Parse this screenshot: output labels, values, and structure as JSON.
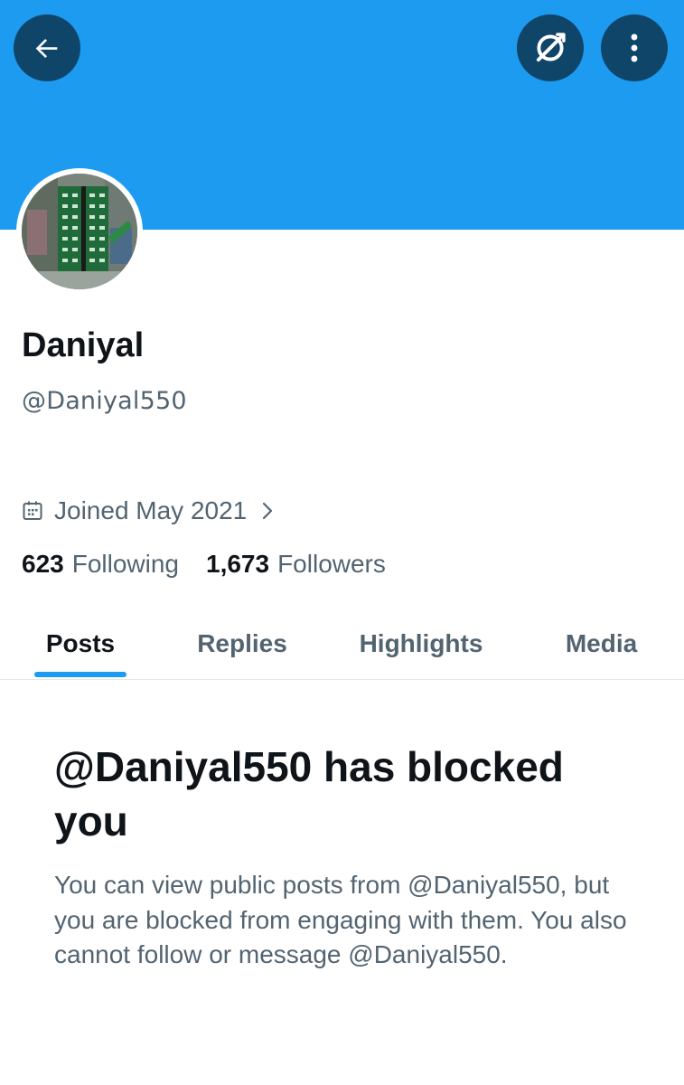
{
  "header": {
    "back_icon": "arrow-left-icon",
    "grok_icon": "grok-icon",
    "more_icon": "more-vertical-icon",
    "banner_color": "#1d9bf0",
    "button_color": "#10456a"
  },
  "profile": {
    "display_name": "Daniyal",
    "handle": "@Daniyal550",
    "joined": "Joined May 2021",
    "joined_icon": "calendar-icon",
    "following_count": "623",
    "following_label": "Following",
    "followers_count": "1,673",
    "followers_label": "Followers"
  },
  "tabs": [
    {
      "label": "Posts",
      "active": true
    },
    {
      "label": "Replies",
      "active": false
    },
    {
      "label": "Highlights",
      "active": false
    },
    {
      "label": "Media",
      "active": false
    }
  ],
  "blocked": {
    "title": "@Daniyal550 has blocked you",
    "description": "You can view public posts from @Daniyal550, but you are blocked from engaging with them. You also cannot follow or message @Daniyal550."
  },
  "colors": {
    "accent": "#1d9bf0",
    "text_primary": "#0f1419",
    "text_secondary": "#536471"
  }
}
